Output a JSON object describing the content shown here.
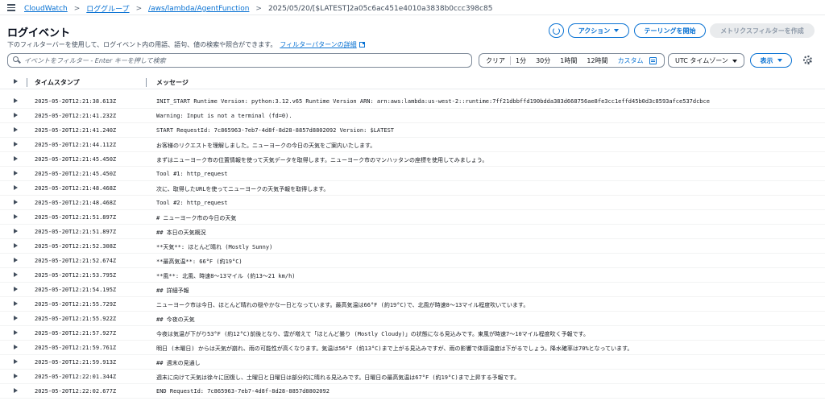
{
  "breadcrumb": {
    "items": [
      "CloudWatch",
      "ロググループ",
      "/aws/lambda/AgentFunction"
    ],
    "current": "2025/05/20/[$LATEST]2a05c6ac451e4010a3838b0ccc398c85"
  },
  "header": {
    "title": "ログイベント",
    "description": "下のフィルターバーを使用して、ログイベント内の用語、語句、値の検索や照合ができます。",
    "pattern_link": "フィルターパターンの詳細",
    "actions_label": "アクション",
    "tail_label": "テーリングを開始",
    "metric_filter_label": "メトリクスフィルターを作成"
  },
  "filter": {
    "search_placeholder": "イベントをフィルター - Enter キーを押して検索",
    "clear_label": "クリア",
    "ranges": [
      "1分",
      "30分",
      "1時間",
      "12時間"
    ],
    "custom_label": "カスタム",
    "timezone_label": "UTC タイムゾーン",
    "display_label": "表示"
  },
  "table": {
    "col_timestamp": "タイムスタンプ",
    "col_message": "メッセージ",
    "rows": [
      {
        "ts": "2025-05-20T12:21:38.613Z",
        "msg": "INIT_START Runtime Version: python:3.12.v65 Runtime Version ARN: arn:aws:lambda:us-west-2::runtime:7ff21dbbffd190bdda383d668756ae8fe3cc1effd45b0d3c8593afce537dcbce"
      },
      {
        "ts": "2025-05-20T12:21:41.232Z",
        "msg": "Warning: Input is not a terminal (fd=0)."
      },
      {
        "ts": "2025-05-20T12:21:41.240Z",
        "msg": "START RequestId: 7c865963-7eb7-4d8f-8d28-8857d8802092 Version: $LATEST"
      },
      {
        "ts": "2025-05-20T12:21:44.112Z",
        "msg": "お客様のリクエストを理解しました。ニューヨークの今日の天気をご案内いたします。"
      },
      {
        "ts": "2025-05-20T12:21:45.450Z",
        "msg": "まずはニューヨーク市の位置情報を使って天気データを取得します。ニューヨーク市のマンハッタンの座標を使用してみましょう。"
      },
      {
        "ts": "2025-05-20T12:21:45.450Z",
        "msg": "Tool #1: http_request"
      },
      {
        "ts": "2025-05-20T12:21:48.468Z",
        "msg": "次に、取得したURLを使ってニューヨークの天気予報を取得します。"
      },
      {
        "ts": "2025-05-20T12:21:48.468Z",
        "msg": "Tool #2: http_request"
      },
      {
        "ts": "2025-05-20T12:21:51.897Z",
        "msg": "# ニューヨーク市の今日の天気"
      },
      {
        "ts": "2025-05-20T12:21:51.897Z",
        "msg": "## 本日の天気概況"
      },
      {
        "ts": "2025-05-20T12:21:52.308Z",
        "msg": "**天気**: ほとんど晴れ (Mostly Sunny)"
      },
      {
        "ts": "2025-05-20T12:21:52.674Z",
        "msg": "**最高気温**: 66°F (約19°C)"
      },
      {
        "ts": "2025-05-20T12:21:53.795Z",
        "msg": "**風**: 北風、時速8～13マイル (約13～21 km/h)"
      },
      {
        "ts": "2025-05-20T12:21:54.195Z",
        "msg": "## 詳細予報"
      },
      {
        "ts": "2025-05-20T12:21:55.729Z",
        "msg": "ニューヨーク市は今日、ほとんど晴れの穏やかな一日となっています。最高気温は66°F (約19°C)で、北風が時速8～13マイル程度吹いています。"
      },
      {
        "ts": "2025-05-20T12:21:55.922Z",
        "msg": "## 今夜の天気"
      },
      {
        "ts": "2025-05-20T12:21:57.927Z",
        "msg": "今夜は気温が下がり53°F (約12°C)前後となり、雲が増えて「ほとんど曇り (Mostly Cloudy)」の状態になる見込みです。東風が時速7～10マイル程度吹く予報です。"
      },
      {
        "ts": "2025-05-20T12:21:59.761Z",
        "msg": "明日 (木曜日) からは天気が崩れ、雨の可能性が高くなります。気温は56°F (約13°C)まで上がる見込みですが、雨の影響で体感温度は下がるでしょう。降水確率は70%となっています。"
      },
      {
        "ts": "2025-05-20T12:21:59.913Z",
        "msg": "## 週末の見通し"
      },
      {
        "ts": "2025-05-20T12:22:01.344Z",
        "msg": "週末に向けて天気は徐々に回復し、土曜日と日曜日は部分的に晴れる見込みです。日曜日の最高気温は67°F (約19°C)まで上昇する予報です。"
      },
      {
        "ts": "2025-05-20T12:22:02.677Z",
        "msg": "END RequestId: 7c865963-7eb7-4d8f-8d28-8857d8802092"
      }
    ]
  },
  "colors": {
    "link": "#0972d3",
    "text": "#16191f",
    "muted": "#5f6b7a",
    "disabled_bg": "#e9ebed"
  }
}
